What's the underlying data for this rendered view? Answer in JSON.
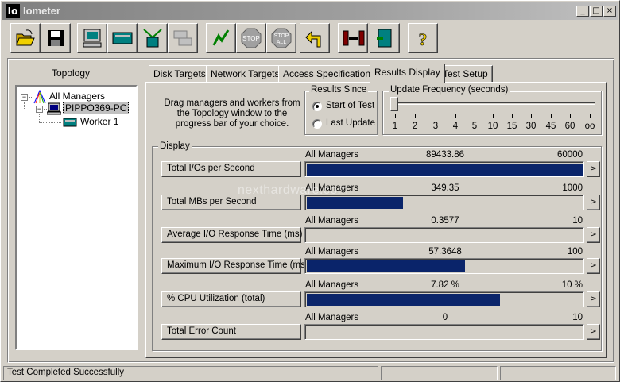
{
  "window": {
    "app_icon": "Io",
    "title": "Iometer",
    "buttons": {
      "minimize": "_",
      "maximize": "□",
      "close": "×"
    }
  },
  "toolbar": {
    "buttons": [
      "open-folder-icon",
      "save-disk-icon",
      "show-results-icon",
      "new-manager-icon",
      "new-disk-worker-icon",
      "new-network-worker-icon",
      "start-tests-icon",
      "stop-test-icon",
      "stop-all-icon",
      "reset-workers-icon",
      "exit-icon",
      "about-icon"
    ],
    "stop_label": "STOP",
    "stop_all_top": "STOP",
    "stop_all_bottom": "ALL",
    "help_glyph": "?"
  },
  "topology": {
    "title": "Topology",
    "root": "All Managers",
    "manager": "PIPPO369-PC",
    "worker": "Worker 1"
  },
  "tabs": [
    {
      "label": "Disk Targets",
      "active": false
    },
    {
      "label": "Network Targets",
      "active": false
    },
    {
      "label": "Access Specifications",
      "active": false
    },
    {
      "label": "Results Display",
      "active": true
    },
    {
      "label": "Test Setup",
      "active": false
    }
  ],
  "instructions": "Drag managers and workers from the Topology window to the progress bar of your choice.",
  "results_since": {
    "title": "Results Since",
    "options": [
      {
        "label": "Start of Test",
        "checked": true
      },
      {
        "label": "Last Update",
        "checked": false
      }
    ]
  },
  "update_frequency": {
    "title": "Update Frequency (seconds)",
    "ticks": [
      "1",
      "2",
      "3",
      "4",
      "5",
      "10",
      "15",
      "30",
      "45",
      "60",
      "oo"
    ],
    "selected_index": 0
  },
  "display": {
    "title": "Display",
    "more_glyph": ">",
    "metrics": [
      {
        "label": "Total I/Os per Second",
        "source": "All Managers",
        "value": "89433.86",
        "max": "60000",
        "fill": 1.0
      },
      {
        "label": "Total MBs per Second",
        "source": "All Managers",
        "value": "349.35",
        "max": "1000",
        "fill": 0.349
      },
      {
        "label": "Average I/O Response Time (ms)",
        "source": "All Managers",
        "value": "0.3577",
        "max": "10",
        "fill": 0.0
      },
      {
        "label": "Maximum I/O Response Time (ms)",
        "source": "All Managers",
        "value": "57.3648",
        "max": "100",
        "fill": 0.574
      },
      {
        "label": "% CPU Utilization (total)",
        "source": "All Managers",
        "value": "7.82 %",
        "max": "10 %",
        "fill": 0.7
      },
      {
        "label": "Total Error Count",
        "source": "All Managers",
        "value": "0",
        "max": "10",
        "fill": 0.0
      }
    ]
  },
  "watermark": "nexthardware.com",
  "status": {
    "message": "Test Completed Successfully"
  },
  "colors": {
    "bar": "#0a246a",
    "face": "#d4d0c8"
  }
}
